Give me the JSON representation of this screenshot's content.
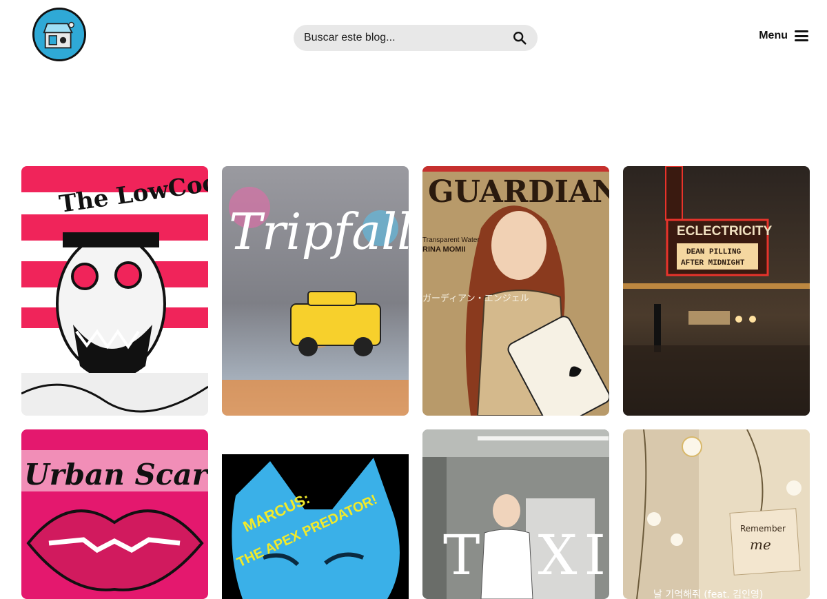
{
  "header": {
    "logo_name": "treasure-chest-logo",
    "search": {
      "placeholder": "Buscar este blog..."
    },
    "menu_label": "Menu"
  },
  "posts": [
    {
      "title_art": "The LowCocks",
      "colors": [
        "#f0245a",
        "#ffffff",
        "#111111"
      ]
    },
    {
      "title_art": "Tripfall",
      "colors": [
        "#8a8a92",
        "#f7d02c",
        "#5bc0e8"
      ]
    },
    {
      "title_art": "GUARDIAN ANGEL",
      "subtitle_art": "Transparent Water",
      "artist_art": "RINA MOMII",
      "japanese_art": "ガーディアン・エンジェル",
      "colors": [
        "#b89a6a",
        "#d4b98c",
        "#2a1a0e"
      ]
    },
    {
      "marquee_art": "ECLECTRICITY",
      "line1_art": "DEAN PILLING",
      "line2_art": "AFTER MIDNIGHT",
      "colors": [
        "#2a241f",
        "#e8332b",
        "#f5d7a0"
      ]
    },
    {
      "title_art": "Urban Scarlet",
      "colors": [
        "#e4186e",
        "#f7c1d6",
        "#111111"
      ]
    },
    {
      "title_art_line1": "MARCUS:",
      "title_art_line2": "THE APEX PREDATOR!",
      "colors": [
        "#000000",
        "#3ab0e8",
        "#f2ea2a"
      ]
    },
    {
      "title_art": "TOXIC",
      "colors": [
        "#8b8e8a",
        "#e8e8e6",
        "#ffffff"
      ]
    },
    {
      "note_art_line1": "Remember",
      "note_art_line2": "me",
      "caption_art": "날 기억해줘 (feat. 김인영)",
      "colors": [
        "#d8c8ac",
        "#f3e6cf",
        "#7a5a3a"
      ]
    }
  ]
}
